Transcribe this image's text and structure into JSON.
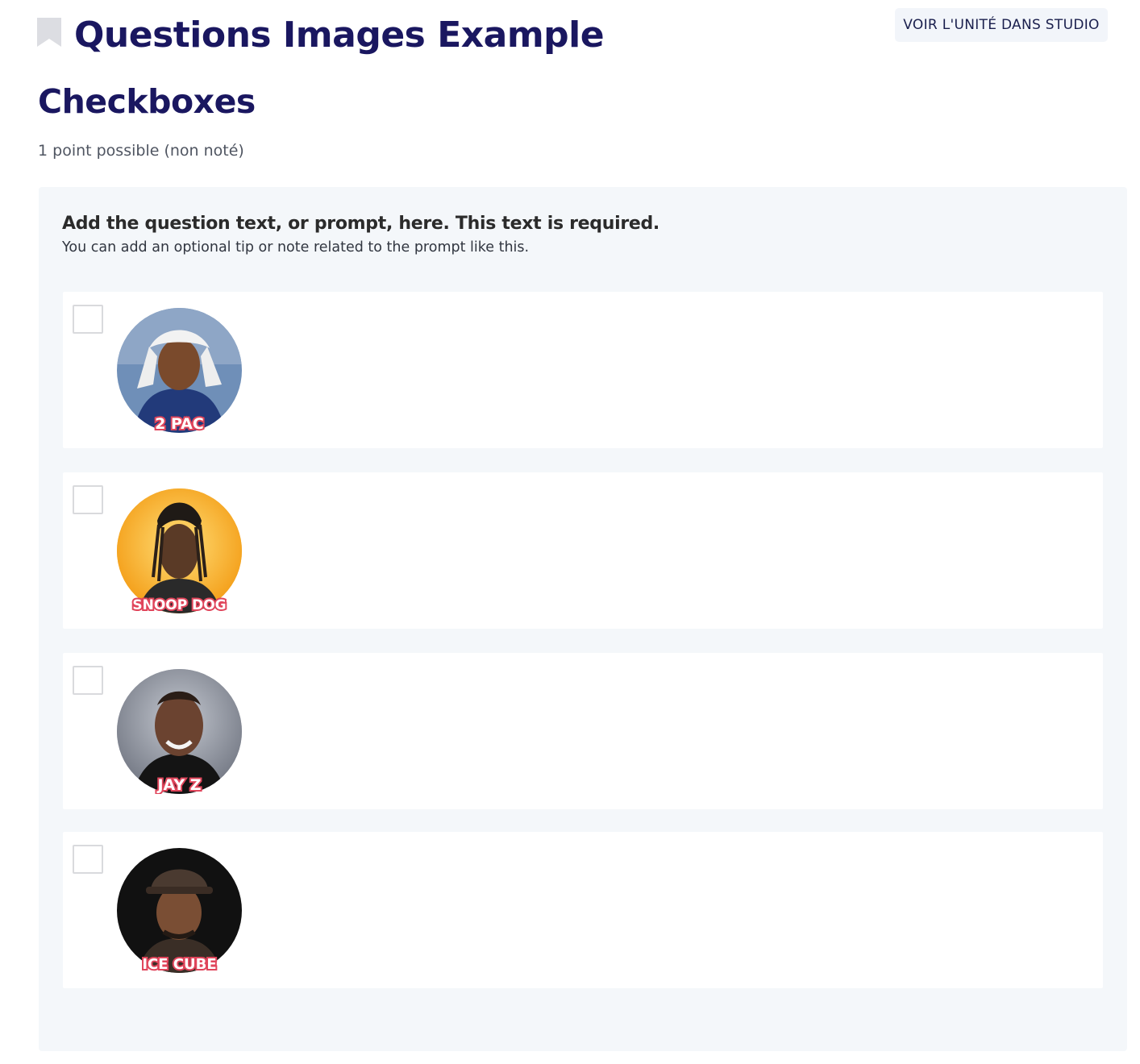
{
  "header": {
    "unit_title": "Questions Images Example",
    "studio_button_label": "VOIR L'UNITÉ DANS STUDIO"
  },
  "problem": {
    "title": "Checkboxes",
    "points": "1 point possible (non noté)",
    "prompt": "Add the question text, or prompt, here. This text is required.",
    "tip": "You can add an optional tip or note related to the prompt like this.",
    "choices": [
      {
        "image_caption": "2 PAC",
        "image_background": "#6f8fb8",
        "checked": false
      },
      {
        "image_caption": "SNOOP DOG",
        "image_background": "#f6a81c",
        "checked": false
      },
      {
        "image_caption": "JAY Z",
        "image_background": "#9aa0ac",
        "checked": false
      },
      {
        "image_caption": "ICE CUBE",
        "image_background": "#111111",
        "checked": false
      }
    ]
  },
  "colors": {
    "title": "#1a1760",
    "panel": "#f4f7fa",
    "caption_text": "#ffffff",
    "caption_outline": "#e0455b"
  }
}
